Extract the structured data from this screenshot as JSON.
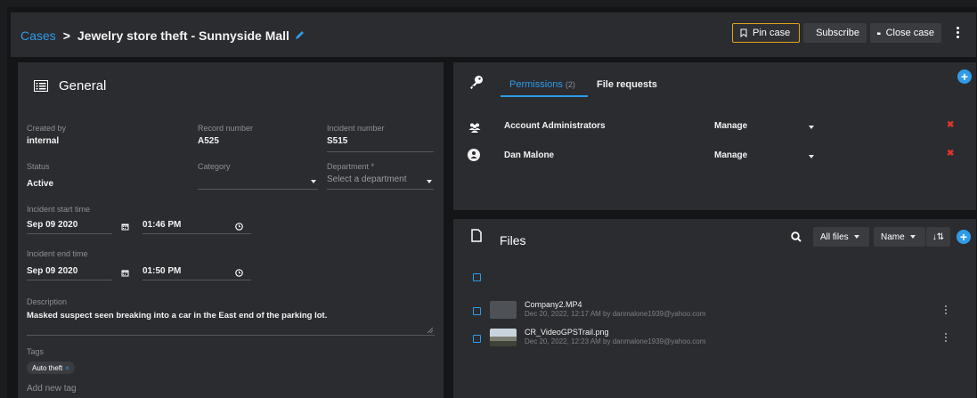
{
  "header": {
    "breadcrumb_root": "Cases",
    "breadcrumb_sep": ">",
    "title": "Jewelry store theft - Sunnyside Mall",
    "pin_label": "Pin case",
    "subscribe_label": "Subscribe",
    "close_label": "Close case"
  },
  "general": {
    "title": "General",
    "created_by_label": "Created by",
    "created_by": "internal",
    "record_number_label": "Record number",
    "record_number": "A525",
    "incident_number_label": "Incident number",
    "incident_number": "S515",
    "status_label": "Status",
    "status": "Active",
    "category_label": "Category",
    "category": "",
    "department_label": "Department *",
    "department_placeholder": "Select a department",
    "start_label": "Incident start time",
    "start_date": "Sep 09 2020",
    "start_time": "01:46 PM",
    "end_label": "Incident end time",
    "end_date": "Sep 09 2020",
    "end_time": "01:50 PM",
    "description_label": "Description",
    "description": "Masked suspect seen breaking into a car in the East end of the parking lot.",
    "tags_label": "Tags",
    "tags": [
      "Auto theft"
    ],
    "add_tag_placeholder": "Add new tag"
  },
  "permissions": {
    "tab_active": "Permissions",
    "tab_count": "(2)",
    "tab_other": "File requests",
    "rows": [
      {
        "name": "Account Administrators",
        "role": "Manage",
        "icon": "group-icon"
      },
      {
        "name": "Dan Malone",
        "role": "Manage",
        "icon": "user-icon"
      }
    ]
  },
  "files": {
    "title": "Files",
    "filter_label": "All files",
    "sort_label": "Name",
    "items": [
      {
        "name": "Company2.MP4",
        "meta": "Dec 20, 2022, 12:17 AM by danmalone1939@yahoo.com"
      },
      {
        "name": "CR_VideoGPSTrail.png",
        "meta": "Dec 20, 2022, 12:23 AM by danmalone1939@yahoo.com"
      }
    ]
  },
  "colors": {
    "accent": "#2f9be8",
    "pin_border": "#e0a21c",
    "remove": "#e0342a"
  }
}
